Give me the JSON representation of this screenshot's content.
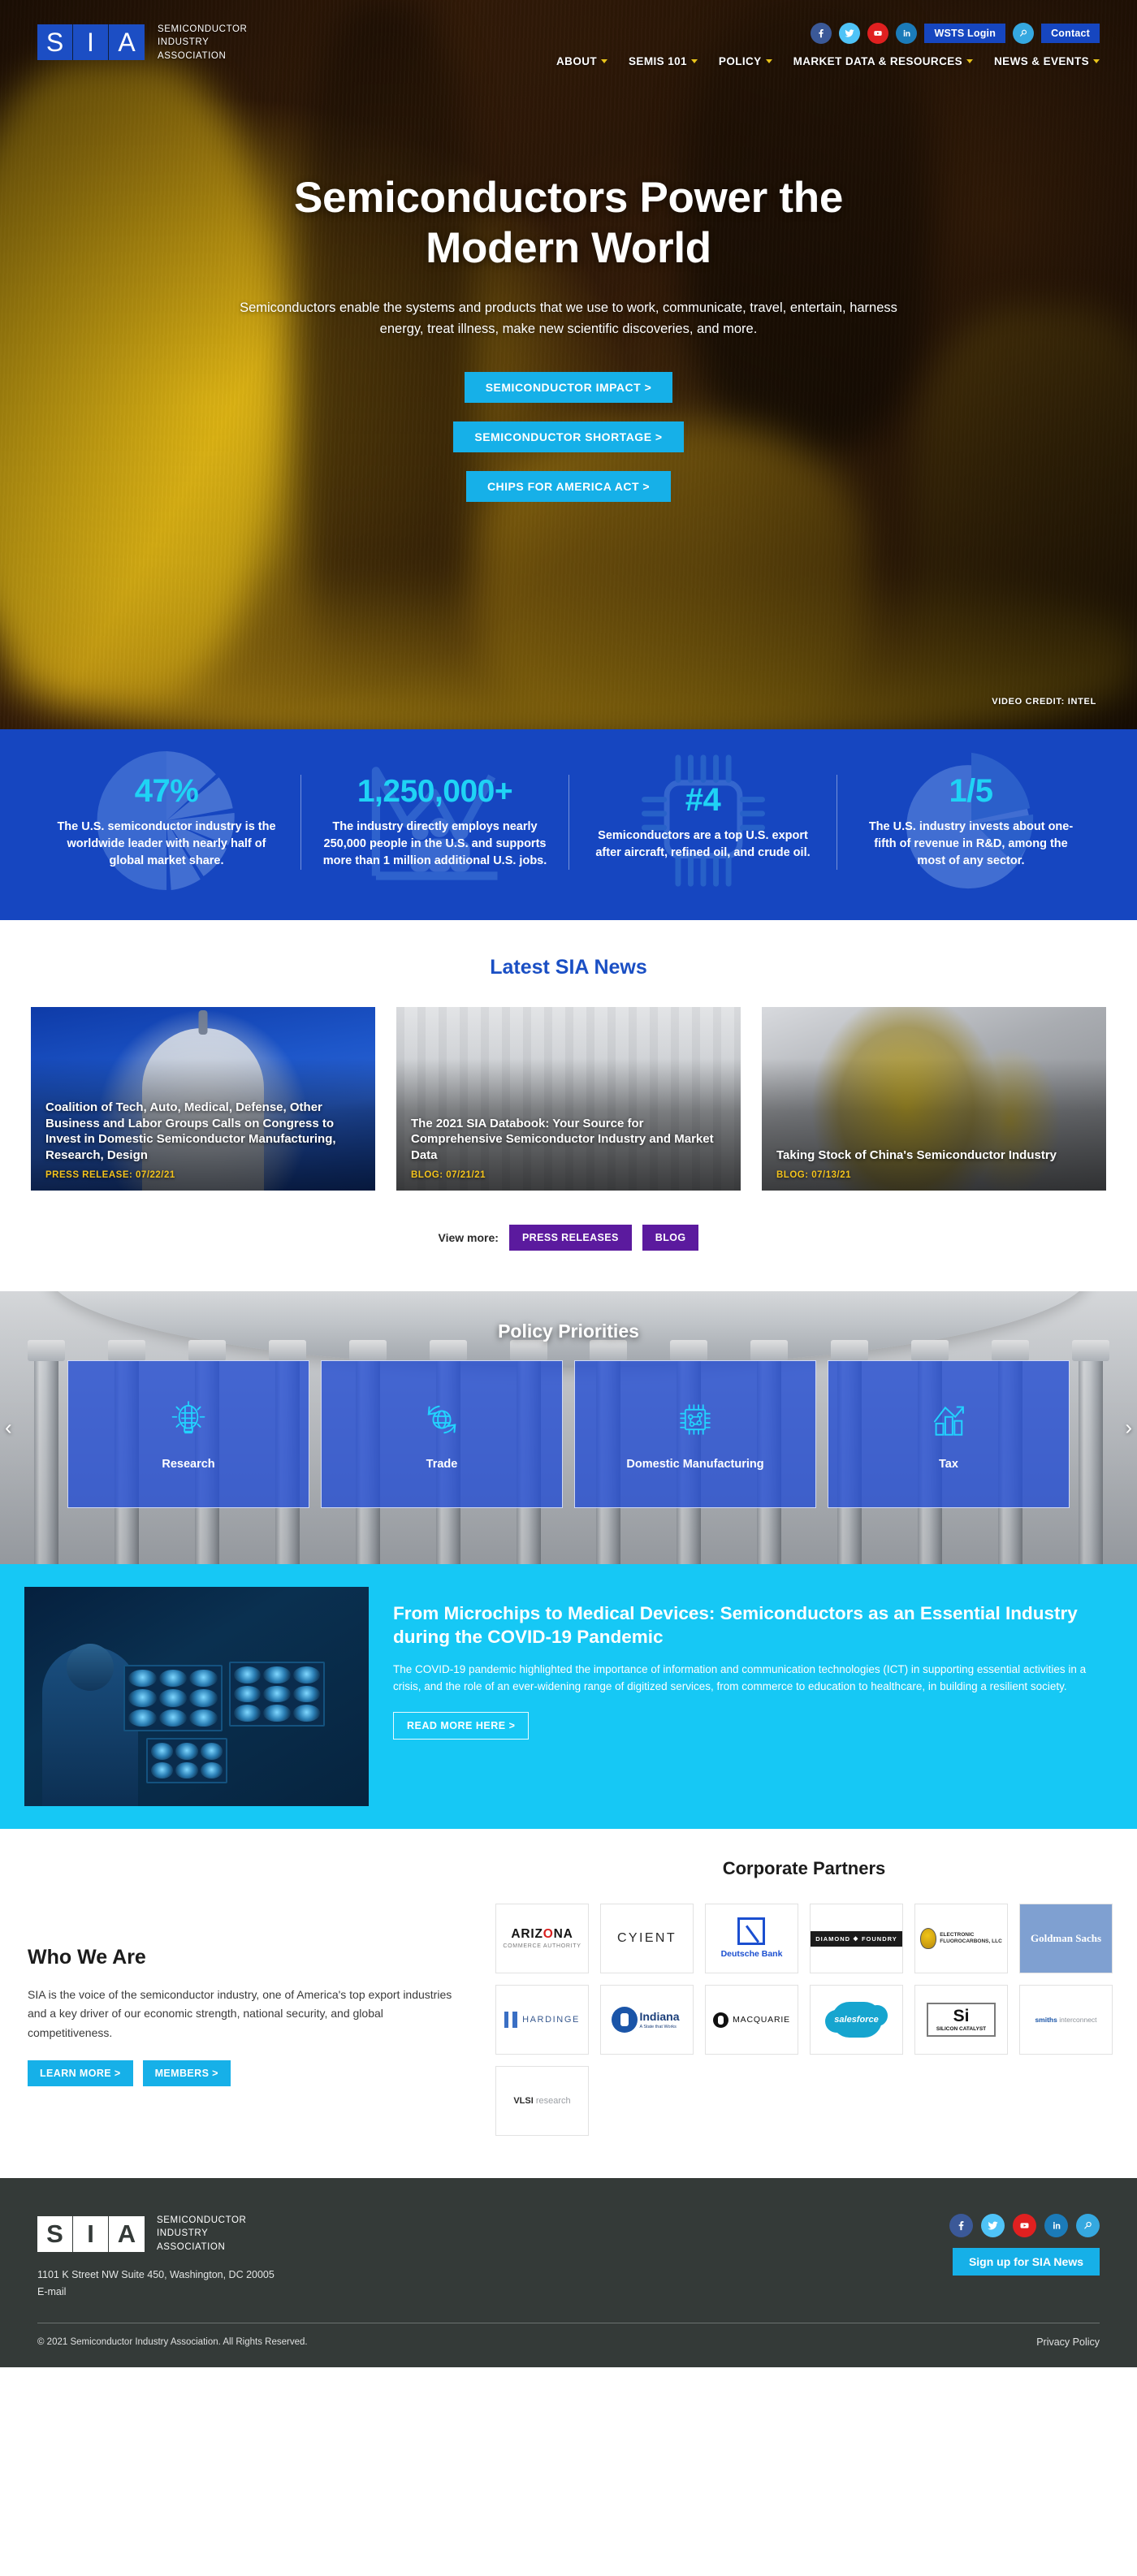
{
  "brand": {
    "logo_letters": [
      "S",
      "I",
      "A"
    ],
    "name_lines": [
      "SEMICONDUCTOR",
      "INDUSTRY",
      "ASSOCIATION"
    ]
  },
  "header": {
    "social": [
      {
        "name": "facebook-icon",
        "color": "#3b5998"
      },
      {
        "name": "twitter-icon",
        "color": "#4fc3f7"
      },
      {
        "name": "youtube-icon",
        "color": "#e02020"
      },
      {
        "name": "linkedin-icon",
        "color": "#1b7bb9"
      },
      {
        "name": "search-icon",
        "color": "#35a8e0"
      }
    ],
    "wsts_login": "WSTS Login",
    "contact": "Contact",
    "nav": [
      {
        "label": "ABOUT",
        "has_caret": true
      },
      {
        "label": "SEMIS 101",
        "has_caret": true
      },
      {
        "label": "POLICY",
        "has_caret": true
      },
      {
        "label": "MARKET DATA & RESOURCES",
        "has_caret": true
      },
      {
        "label": "NEWS & EVENTS",
        "has_caret": true
      }
    ]
  },
  "hero": {
    "title_line1": "Semiconductors Power the",
    "title_line2": "Modern World",
    "subtitle": "Semiconductors enable the systems and products that we use to work, communicate, travel, entertain, harness energy, treat illness, make new scientific discoveries, and more.",
    "buttons": [
      "SEMICONDUCTOR IMPACT >",
      "SEMICONDUCTOR SHORTAGE >",
      "CHIPS FOR AMERICA ACT >"
    ],
    "video_credit": "VIDEO CREDIT: INTEL",
    "accent_color": "#16b0e8"
  },
  "stats": {
    "background_color": "#1646c0",
    "number_color": "#1fd3f5",
    "items": [
      {
        "number": "47%",
        "text": "The U.S. semiconductor industry is the worldwide leader with nearly half of global market share.",
        "icon": "pie-chart-icon"
      },
      {
        "number": "1,250,000+",
        "text": "The industry directly employs nearly 250,000 people in the U.S. and supports more than 1 million additional U.S. jobs.",
        "icon": "people-growth-chart-icon"
      },
      {
        "number": "#4",
        "text": "Semiconductors are a top U.S. export after aircraft, refined oil, and crude oil.",
        "icon": "microchip-icon"
      },
      {
        "number": "1/5",
        "text": "The U.S. industry invests about one-fifth of revenue in R&D, among the most of any sector.",
        "icon": "pie-slice-icon"
      }
    ]
  },
  "news": {
    "heading": "Latest SIA News",
    "cards": [
      {
        "title": "Coalition of Tech, Auto, Medical, Defense, Other Business and Labor Groups Calls on Congress to Invest in Domestic Semiconductor Manufacturing, Research, Design",
        "meta": "PRESS RELEASE: 07/22/21"
      },
      {
        "title": "The 2021 SIA Databook: Your Source for Comprehensive Semiconductor Industry and Market Data",
        "meta": "BLOG: 07/21/21"
      },
      {
        "title": "Taking Stock of China's Semiconductor Industry",
        "meta": "BLOG: 07/13/21"
      }
    ],
    "view_more_label": "View more:",
    "view_more_buttons": [
      "PRESS RELEASES",
      "BLOG"
    ],
    "view_more_color": "#5b1a9e"
  },
  "policy": {
    "heading": "Policy Priorities",
    "prev_arrow": "‹",
    "next_arrow": "›",
    "tiles": [
      {
        "label": "Research",
        "icon": "lightbulb-circuit-icon"
      },
      {
        "label": "Trade",
        "icon": "globe-arrows-icon"
      },
      {
        "label": "Domestic Manufacturing",
        "icon": "microchip-circuit-icon"
      },
      {
        "label": "Tax",
        "icon": "bar-chart-arrow-icon"
      }
    ]
  },
  "covid": {
    "background_color": "#16c8f5",
    "title": "From Microchips to Medical Devices: Semiconductors as an Essential Industry during the COVID-19 Pandemic",
    "text": "The COVID-19 pandemic highlighted the importance of information and communication technologies (ICT) in supporting essential activities in a crisis, and the role of an ever-widening range of digitized services, from commerce to education to healthcare, in building a resilient society.",
    "button": "READ MORE HERE >"
  },
  "who_we_are": {
    "heading": "Who We Are",
    "text": "SIA is the voice of the semiconductor industry, one of America's top export industries and a key driver of our economic strength, national security, and global competitiveness.",
    "buttons": [
      "LEARN MORE >",
      "MEMBERS >"
    ]
  },
  "partners": {
    "heading": "Corporate Partners",
    "logos": [
      {
        "key": "arizona",
        "name": "ARIZONA",
        "sub": "COMMERCE AUTHORITY"
      },
      {
        "key": "cyient",
        "name": "CYIENT",
        "sub": ""
      },
      {
        "key": "deutsche-bank",
        "name": "Deutsche Bank",
        "sub": ""
      },
      {
        "key": "diamond-foundry",
        "name": "DIAMOND ❖ FOUNDRY",
        "sub": ""
      },
      {
        "key": "electronic-fluorocarbons",
        "name": "ELECTRONIC",
        "sub": "FLUOROCARBONS, LLC"
      },
      {
        "key": "goldman-sachs",
        "name": "Goldman Sachs",
        "sub": ""
      },
      {
        "key": "hardinge",
        "name": "HARDINGE",
        "sub": ""
      },
      {
        "key": "indiana",
        "name": "Indiana",
        "sub": "A State that Works"
      },
      {
        "key": "macquarie",
        "name": "MACQUARIE",
        "sub": ""
      },
      {
        "key": "salesforce",
        "name": "salesforce",
        "sub": ""
      },
      {
        "key": "silicon-catalyst",
        "name": "Si",
        "sub": "SILICON CATALYST"
      },
      {
        "key": "smiths-interconnect",
        "name": "smiths",
        "sub": "interconnect"
      },
      {
        "key": "vlsi-research",
        "name": "VLSI",
        "sub": "research"
      }
    ]
  },
  "footer": {
    "address": "1101 K Street NW Suite 450, Washington, DC 20005",
    "email_label": "E-mail",
    "social": [
      {
        "name": "facebook-icon",
        "color": "#3b5998"
      },
      {
        "name": "twitter-icon",
        "color": "#4fc3f7"
      },
      {
        "name": "youtube-icon",
        "color": "#e02020"
      },
      {
        "name": "linkedin-icon",
        "color": "#1b7bb9"
      },
      {
        "name": "search-icon",
        "color": "#35a8e0"
      }
    ],
    "signup_label": "Sign up for SIA News",
    "copyright": "© 2021 Semiconductor Industry Association. All Rights Reserved.",
    "privacy": "Privacy Policy"
  }
}
